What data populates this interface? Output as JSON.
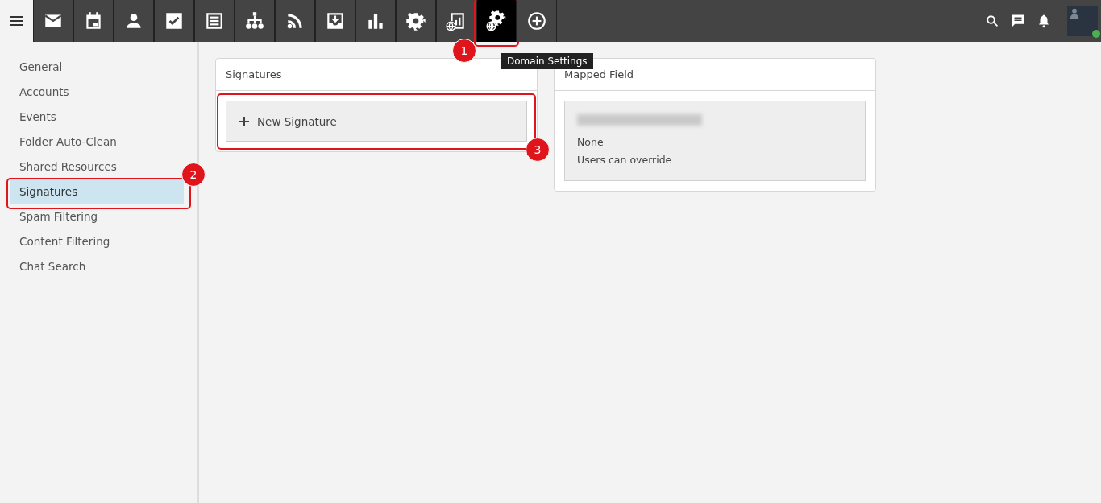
{
  "toolbar": {
    "tools": [
      {
        "kind": "mail",
        "selected": false
      },
      {
        "kind": "calendar",
        "selected": false
      },
      {
        "kind": "contact",
        "selected": false
      },
      {
        "kind": "task",
        "selected": false
      },
      {
        "kind": "note",
        "selected": false
      },
      {
        "kind": "tree",
        "selected": false
      },
      {
        "kind": "feed",
        "selected": false
      },
      {
        "kind": "inbox",
        "selected": false
      },
      {
        "kind": "chart",
        "selected": false
      },
      {
        "kind": "gear",
        "selected": false
      },
      {
        "kind": "report-globe",
        "selected": false
      },
      {
        "kind": "gear-globe",
        "selected": true,
        "callout": "1",
        "tooltip": "Domain Settings"
      },
      {
        "kind": "add",
        "selected": false
      }
    ]
  },
  "sidebar": {
    "items": [
      {
        "label": "General",
        "selected": false
      },
      {
        "label": "Accounts",
        "selected": false
      },
      {
        "label": "Events",
        "selected": false
      },
      {
        "label": "Folder Auto-Clean",
        "selected": false
      },
      {
        "label": "Shared Resources",
        "selected": false
      },
      {
        "label": "Signatures",
        "selected": true,
        "callout": "2"
      },
      {
        "label": "Spam Filtering",
        "selected": false
      },
      {
        "label": "Content Filtering",
        "selected": false
      },
      {
        "label": "Chat Search",
        "selected": false
      }
    ]
  },
  "signatures_card": {
    "title": "Signatures",
    "new_button": {
      "label": "New Signature",
      "callout": "3"
    }
  },
  "mapped_field_card": {
    "title": "Mapped Field",
    "entry": {
      "line_2": "None",
      "line_3": "Users can override"
    }
  }
}
